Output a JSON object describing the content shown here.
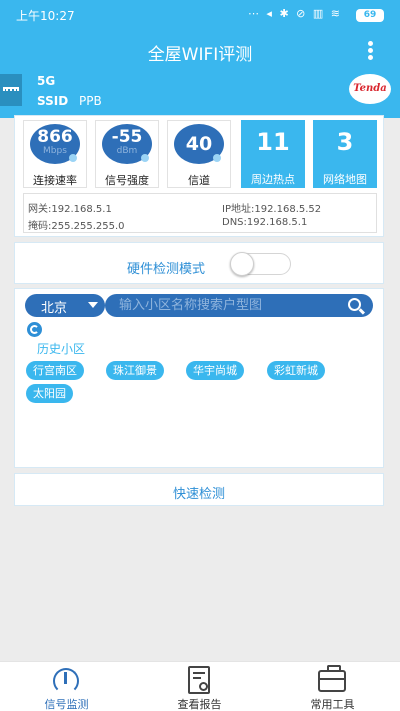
{
  "status_bar": {
    "time": "上午10:27",
    "icons": "⋯ ◂ ✱ ⊘ ▥ ≋",
    "battery": "69"
  },
  "header": {
    "title": "全屋WIFI评测"
  },
  "wifi": {
    "band": "5G",
    "ssid_label": "SSID",
    "ssid_value": "PPB",
    "logo": "Tenda"
  },
  "stats": [
    {
      "value": "866",
      "unit": "Mbps",
      "label": "连接速率"
    },
    {
      "value": "-55",
      "unit": "dBm",
      "label": "信号强度"
    },
    {
      "value": "40",
      "unit": "",
      "label": "信道"
    }
  ],
  "tiles": [
    {
      "value": "11",
      "label": "周边热点"
    },
    {
      "value": "3",
      "label": "网络地图"
    }
  ],
  "network": {
    "gateway": "网关:192.168.5.1",
    "ip": "IP地址:192.168.5.52",
    "mask": "掩码:255.255.255.0",
    "dns": "DNS:192.168.5.1"
  },
  "mode": {
    "label": "硬件检测模式",
    "enabled": false
  },
  "search": {
    "city": "北京",
    "placeholder": "输入小区名称搜索户型图",
    "history_label": "历史小区",
    "history": [
      "行宫南区",
      "珠江御景",
      "华宇尚城",
      "彩虹新城",
      "太阳园"
    ]
  },
  "quick_check": {
    "label": "快速检测"
  },
  "tabs": [
    {
      "label": "信号监测",
      "active": true,
      "icon": "gauge-icon"
    },
    {
      "label": "查看报告",
      "active": false,
      "icon": "report-icon"
    },
    {
      "label": "常用工具",
      "active": false,
      "icon": "toolbox-icon"
    }
  ],
  "colors": {
    "accent": "#3ab7ee",
    "primary": "#2e6fb8",
    "link": "#2e8fd6"
  }
}
